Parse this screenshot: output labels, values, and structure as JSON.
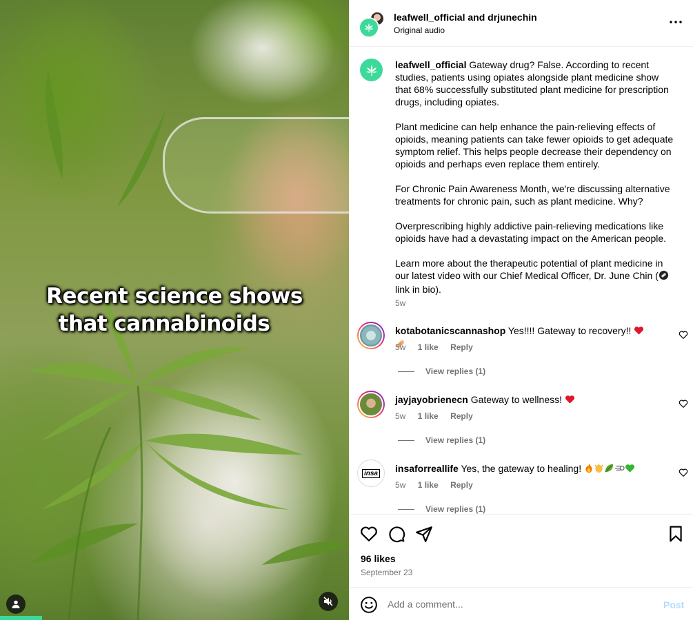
{
  "video": {
    "caption_line1": "Recent science shows",
    "caption_line2": "that cannabinoids",
    "progress": 0.12
  },
  "header": {
    "usernames": "leafwell_official and drjunechin",
    "audio": "Original audio"
  },
  "post": {
    "author": "leafwell_official",
    "paragraphs": [
      "Gateway drug? False. According to recent studies, patients using opiates alongside plant medicine show that 68% successfully substituted plant medicine for prescription drugs, including opiates.",
      "Plant medicine can help enhance the pain-relieving effects of opioids, meaning patients can take fewer opioids to get adequate symptom relief. This helps people decrease their dependency on opioids and perhaps even replace them entirely.",
      "For Chronic Pain Awareness Month, we're discussing alternative treatments for chronic pain, such as plant medicine. Why?",
      "Overprescribing highly addictive pain-relieving medications like opioids have had a devastating impact on the American people.",
      "Learn more about the therapeutic potential of plant medicine in our latest video with our Chief Medical Officer, Dr. June Chin (",
      "link in bio)."
    ],
    "time": "5w"
  },
  "comments": [
    {
      "username": "kotabotanicscannashop",
      "text": "Yes!!!! Gateway to recovery!!",
      "time": "5w",
      "likes": "1 like",
      "reply": "Reply",
      "view_replies": "View replies (1)"
    },
    {
      "username": "jayjayobrienecn",
      "text": "Gateway to wellness!",
      "time": "5w",
      "likes": "1 like",
      "reply": "Reply",
      "view_replies": "View replies (1)"
    },
    {
      "username": "insaforreallife",
      "text": "Yes, the gateway to healing!",
      "time": "5w",
      "likes": "1 like",
      "reply": "Reply",
      "view_replies": "View replies (1)",
      "avatar_text": "insa"
    }
  ],
  "footer": {
    "likes": "96 likes",
    "date": "September 23"
  },
  "comment_box": {
    "placeholder": "Add a comment...",
    "post_label": "Post"
  },
  "colors": {
    "brand_green": "#3dd99b",
    "muted": "#737373",
    "post_disabled": "#b3dbff"
  },
  "icons": [
    "leaf-logo-icon",
    "more-icon",
    "heart-icon",
    "comment-icon",
    "share-icon",
    "bookmark-icon",
    "emoji-icon",
    "user-icon",
    "mute-icon"
  ]
}
